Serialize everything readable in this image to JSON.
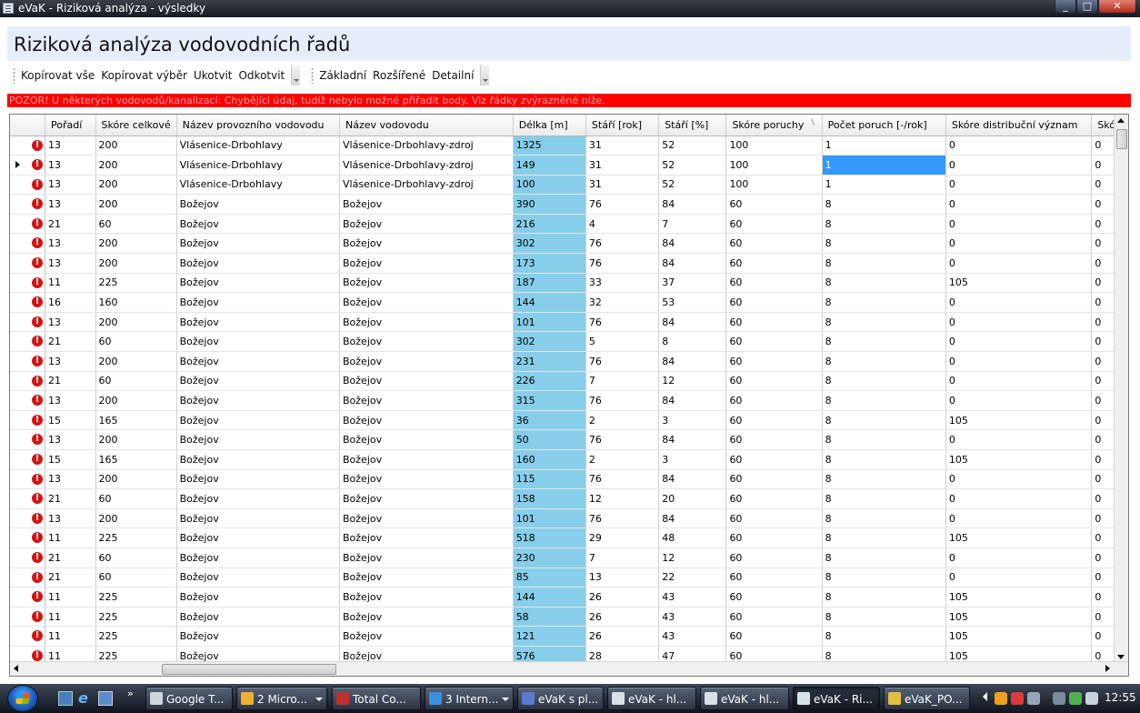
{
  "window": {
    "title": "eVaK - Riziková analýza - výsledky",
    "min": "_",
    "max": "□",
    "close": "✕"
  },
  "header": {
    "title": "Riziková analýza vodovodních řadů"
  },
  "toolbar": {
    "group1": [
      "Kopírovat vše",
      "Kopírovat výběr",
      "Ukotvit",
      "Odkotvit"
    ],
    "group2": [
      "Základní",
      "Rozšířené",
      "Detailní"
    ]
  },
  "warning": "POZOR! U některých vodovodů/kanalizací: Chybějící údaj, tudíž nebylo možné přiřadit body. Viz řádky zvýrazněné níže.",
  "grid": {
    "columns": [
      "Pořadí",
      "Skóre celkové",
      "Název provozního vodovodu",
      "Název vodovodu",
      "Délka [m]",
      "Stáří [rok]",
      "Stáří [%]",
      "Skóre poruchy",
      "Počet poruch [-/rok]",
      "Skóre distribuční význam",
      "Skó"
    ],
    "sorted_column": "Skóre poruchy",
    "current_row": 1,
    "selected_cell": {
      "row": 1,
      "col": 8
    },
    "rows": [
      [
        "13",
        "200",
        "Vlásenice-Drbohlavy",
        "Vlásenice-Drbohlavy-zdroj",
        "1325",
        "31",
        "52",
        "100",
        "1",
        "0",
        "0"
      ],
      [
        "13",
        "200",
        "Vlásenice-Drbohlavy",
        "Vlásenice-Drbohlavy-zdroj",
        "149",
        "31",
        "52",
        "100",
        "1",
        "0",
        "0"
      ],
      [
        "13",
        "200",
        "Vlásenice-Drbohlavy",
        "Vlásenice-Drbohlavy-zdroj",
        "100",
        "31",
        "52",
        "100",
        "1",
        "0",
        "0"
      ],
      [
        "13",
        "200",
        "Božejov",
        "Božejov",
        "390",
        "76",
        "84",
        "60",
        "8",
        "0",
        "0"
      ],
      [
        "21",
        "60",
        "Božejov",
        "Božejov",
        "216",
        "4",
        "7",
        "60",
        "8",
        "0",
        "0"
      ],
      [
        "13",
        "200",
        "Božejov",
        "Božejov",
        "302",
        "76",
        "84",
        "60",
        "8",
        "0",
        "0"
      ],
      [
        "13",
        "200",
        "Božejov",
        "Božejov",
        "173",
        "76",
        "84",
        "60",
        "8",
        "0",
        "0"
      ],
      [
        "11",
        "225",
        "Božejov",
        "Božejov",
        "187",
        "33",
        "37",
        "60",
        "8",
        "105",
        "0"
      ],
      [
        "16",
        "160",
        "Božejov",
        "Božejov",
        "144",
        "32",
        "53",
        "60",
        "8",
        "0",
        "0"
      ],
      [
        "13",
        "200",
        "Božejov",
        "Božejov",
        "101",
        "76",
        "84",
        "60",
        "8",
        "0",
        "0"
      ],
      [
        "21",
        "60",
        "Božejov",
        "Božejov",
        "302",
        "5",
        "8",
        "60",
        "8",
        "0",
        "0"
      ],
      [
        "13",
        "200",
        "Božejov",
        "Božejov",
        "231",
        "76",
        "84",
        "60",
        "8",
        "0",
        "0"
      ],
      [
        "21",
        "60",
        "Božejov",
        "Božejov",
        "226",
        "7",
        "12",
        "60",
        "8",
        "0",
        "0"
      ],
      [
        "13",
        "200",
        "Božejov",
        "Božejov",
        "315",
        "76",
        "84",
        "60",
        "8",
        "0",
        "0"
      ],
      [
        "15",
        "165",
        "Božejov",
        "Božejov",
        "36",
        "2",
        "3",
        "60",
        "8",
        "105",
        "0"
      ],
      [
        "13",
        "200",
        "Božejov",
        "Božejov",
        "50",
        "76",
        "84",
        "60",
        "8",
        "0",
        "0"
      ],
      [
        "15",
        "165",
        "Božejov",
        "Božejov",
        "160",
        "2",
        "3",
        "60",
        "8",
        "105",
        "0"
      ],
      [
        "13",
        "200",
        "Božejov",
        "Božejov",
        "115",
        "76",
        "84",
        "60",
        "8",
        "0",
        "0"
      ],
      [
        "21",
        "60",
        "Božejov",
        "Božejov",
        "158",
        "12",
        "20",
        "60",
        "8",
        "0",
        "0"
      ],
      [
        "13",
        "200",
        "Božejov",
        "Božejov",
        "101",
        "76",
        "84",
        "60",
        "8",
        "0",
        "0"
      ],
      [
        "11",
        "225",
        "Božejov",
        "Božejov",
        "518",
        "29",
        "48",
        "60",
        "8",
        "105",
        "0"
      ],
      [
        "21",
        "60",
        "Božejov",
        "Božejov",
        "230",
        "7",
        "12",
        "60",
        "8",
        "0",
        "0"
      ],
      [
        "21",
        "60",
        "Božejov",
        "Božejov",
        "85",
        "13",
        "22",
        "60",
        "8",
        "0",
        "0"
      ],
      [
        "11",
        "225",
        "Božejov",
        "Božejov",
        "144",
        "26",
        "43",
        "60",
        "8",
        "105",
        "0"
      ],
      [
        "11",
        "225",
        "Božejov",
        "Božejov",
        "58",
        "26",
        "43",
        "60",
        "8",
        "105",
        "0"
      ],
      [
        "11",
        "225",
        "Božejov",
        "Božejov",
        "121",
        "26",
        "43",
        "60",
        "8",
        "105",
        "0"
      ],
      [
        "11",
        "225",
        "Božejov",
        "Božejov",
        "576",
        "28",
        "47",
        "60",
        "8",
        "105",
        "0"
      ]
    ]
  },
  "taskbar": {
    "more": "»",
    "tasks": [
      {
        "label": "Google T...",
        "color": "#cfd6df",
        "arrow": false,
        "active": false
      },
      {
        "label": "2 Micro...",
        "color": "#f0b030",
        "arrow": true,
        "active": false
      },
      {
        "label": "Total Co...",
        "color": "#c03030",
        "arrow": false,
        "active": false
      },
      {
        "label": "3 Intern...",
        "color": "#3a8fe0",
        "arrow": true,
        "active": false
      },
      {
        "label": "eVaK s pl...",
        "color": "#5a7bd0",
        "arrow": false,
        "active": false
      },
      {
        "label": "eVaK - hl...",
        "color": "#d8e0ea",
        "arrow": false,
        "active": false
      },
      {
        "label": "eVaK - hl...",
        "color": "#d8e0ea",
        "arrow": false,
        "active": false
      },
      {
        "label": "eVaK - Ri...",
        "color": "#d8e0ea",
        "arrow": false,
        "active": true
      },
      {
        "label": "eVaK_PO...",
        "color": "#e0c040",
        "arrow": false,
        "active": false
      }
    ],
    "clock": "12:55"
  },
  "colors": {
    "warning": "#fe0000",
    "length_column": "#87ceeb",
    "selection": "#3399ff",
    "error": "#d41313"
  }
}
